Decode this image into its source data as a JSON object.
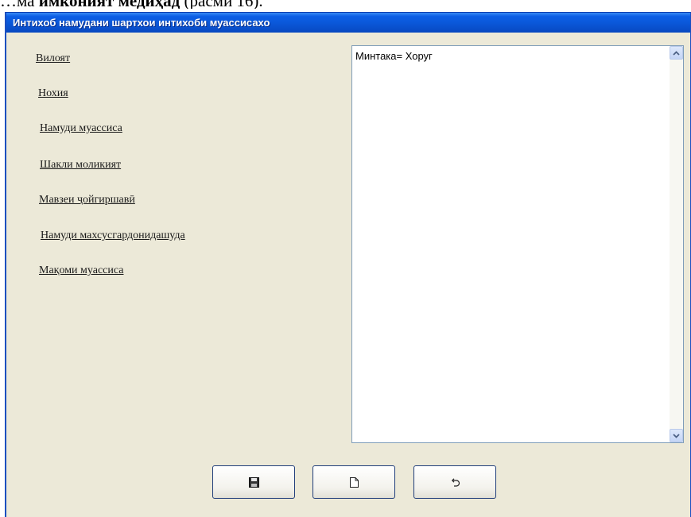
{
  "document_text": {
    "before": "…ма ",
    "bold": "имконият медиҳад",
    "after": " (расми 16)."
  },
  "window": {
    "title": "Интихоб намудани шартхои интихоби муассисахо"
  },
  "criteria_links": [
    {
      "label": "Вилоят"
    },
    {
      "label": "Нохия"
    },
    {
      "label": "Намуди муассиса"
    },
    {
      "label": "Шакли моликият"
    },
    {
      "label": "Мавзеи ҷойгиршавӣ"
    },
    {
      "label": "Намуди махсусгардонидашуда"
    },
    {
      "label": "Мақоми муассиса"
    }
  ],
  "conditions_list": {
    "items": [
      "Минтака= Хоруг"
    ]
  },
  "scrollbar": {
    "up_icon": "arrow-up-icon",
    "down_icon": "arrow-down-icon"
  },
  "buttons": [
    {
      "icon": "save-icon"
    },
    {
      "icon": "new-document-icon"
    },
    {
      "icon": "undo-icon"
    }
  ]
}
